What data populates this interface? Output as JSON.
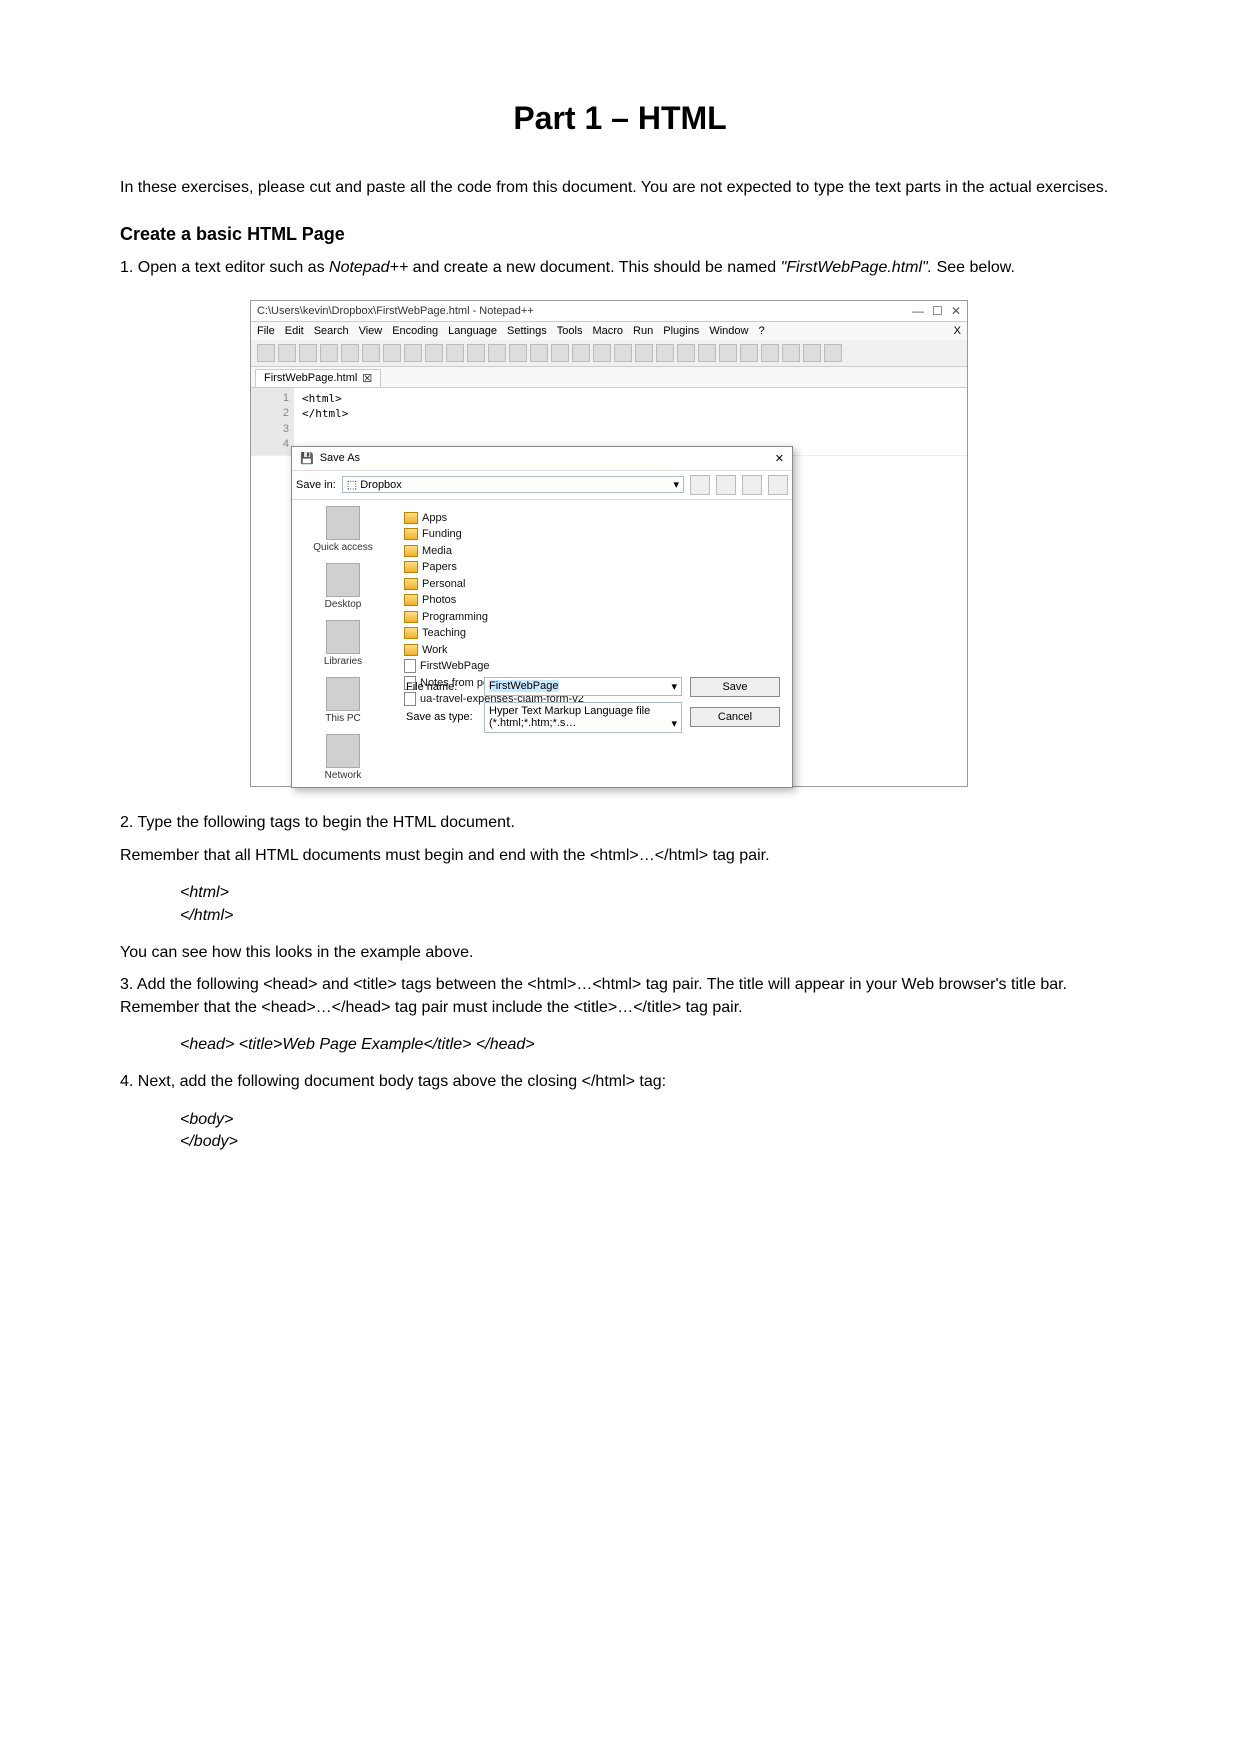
{
  "title": "Part 1 – HTML",
  "intro": "In these exercises, please cut and paste all the code from this document. You are not expected to type the text parts in the actual exercises.",
  "heading": "Create a basic HTML Page",
  "step1_part1": "1. Open a text editor such as ",
  "step1_notepad": "Notepad++",
  "step1_part2": " and create a new document. This should be named ",
  "step1_filename": "\"FirstWebPage.html\".",
  "step1_part3": " See below.",
  "npp": {
    "window_title": "C:\\Users\\kevin\\Dropbox\\FirstWebPage.html - Notepad++",
    "minimize": "—",
    "maximize": "☐",
    "close": "✕",
    "menu": [
      "File",
      "Edit",
      "Search",
      "View",
      "Encoding",
      "Language",
      "Settings",
      "Tools",
      "Macro",
      "Run",
      "Plugins",
      "Window",
      "?"
    ],
    "tab": "FirstWebPage.html",
    "tab_close": "☒",
    "gutter": [
      "1",
      "2",
      "3",
      "4"
    ],
    "code": [
      "<html>",
      "",
      "</html>",
      ""
    ]
  },
  "dialog": {
    "title": "Save As",
    "close": "✕",
    "savein_label": "Save in:",
    "savein_value": "Dropbox",
    "sidebar": [
      {
        "label": "Quick access"
      },
      {
        "label": "Desktop"
      },
      {
        "label": "Libraries"
      },
      {
        "label": "This PC"
      },
      {
        "label": "Network"
      }
    ],
    "folders": [
      "Apps",
      "Funding",
      "Media",
      "Papers",
      "Personal",
      "Photos",
      "Programming",
      "Teaching",
      "Work"
    ],
    "files": [
      "FirstWebPage",
      "Notes from peter about David Abel FB case",
      "ua-travel-expenses-claim-form-v2"
    ],
    "filename_label": "File name:",
    "filename_value": "FirstWebPage",
    "saveastype_label": "Save as type:",
    "saveastype_value": "Hyper Text Markup Language file (*.html;*.htm;*.s…",
    "save_btn": "Save",
    "cancel_btn": "Cancel"
  },
  "step2_a": "2. Type the following tags to begin the HTML document.",
  "step2_b": "Remember that all HTML documents must begin and end with the <html>…</html> tag pair.",
  "code1_a": "<html>",
  "code1_b": "</html>",
  "step2_note": "You can see how this looks in the example above.",
  "step3": "3. Add the following <head> and <title> tags between the <html>…<html> tag pair. The title will appear in your Web browser's title bar. Remember that the <head>…</head> tag pair must include the <title>…</title> tag pair.",
  "code2": "<head> <title>Web Page Example</title> </head>",
  "step4": "4. Next, add the following document body tags above the closing </html> tag:",
  "code3_a": "<body>",
  "code3_b": "</body>"
}
